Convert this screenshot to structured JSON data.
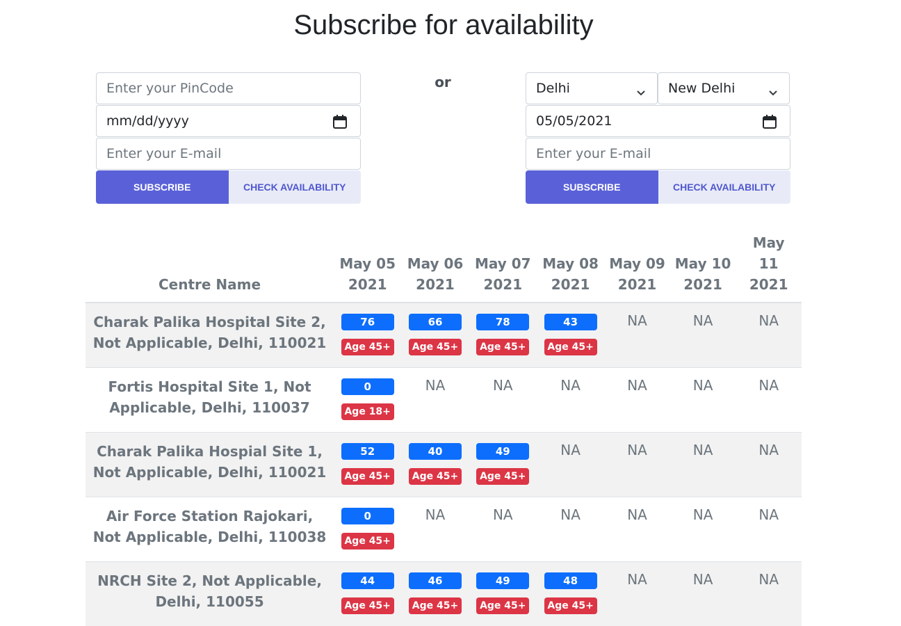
{
  "title": "Subscribe for availability",
  "or_label": "or",
  "left_form": {
    "pincode_placeholder": "Enter your PinCode",
    "date_placeholder": "mm/dd/yyyy",
    "email_placeholder": "Enter your E-mail",
    "subscribe_label": "SUBSCRIBE",
    "check_label": "CHECK AVAILABILITY"
  },
  "right_form": {
    "state_value": "Delhi",
    "district_value": "New Delhi",
    "date_value": "05/05/2021",
    "email_placeholder": "Enter your E-mail",
    "subscribe_label": "SUBSCRIBE",
    "check_label": "CHECK AVAILABILITY"
  },
  "table": {
    "centre_header": "Centre Name",
    "date_headers": [
      [
        "May 05",
        "2021"
      ],
      [
        "May 06",
        "2021"
      ],
      [
        "May 07",
        "2021"
      ],
      [
        "May 08",
        "2021"
      ],
      [
        "May 09",
        "2021"
      ],
      [
        "May 10",
        "2021"
      ],
      [
        "May",
        "11",
        "2021"
      ]
    ],
    "rows": [
      {
        "centre": "Charak Palika Hospital Site 2, Not Applicable, Delhi, 110021",
        "slots": [
          {
            "cap": "76",
            "age": "Age 45+"
          },
          {
            "cap": "66",
            "age": "Age 45+"
          },
          {
            "cap": "78",
            "age": "Age 45+"
          },
          {
            "cap": "43",
            "age": "Age 45+"
          },
          null,
          null,
          null
        ]
      },
      {
        "centre": "Fortis Hospital Site 1, Not Applicable, Delhi, 110037",
        "slots": [
          {
            "cap": "0",
            "age": "Age 18+"
          },
          null,
          null,
          null,
          null,
          null,
          null
        ]
      },
      {
        "centre": "Charak Palika Hospial Site 1, Not Applicable, Delhi, 110021",
        "slots": [
          {
            "cap": "52",
            "age": "Age 45+"
          },
          {
            "cap": "40",
            "age": "Age 45+"
          },
          {
            "cap": "49",
            "age": "Age 45+"
          },
          null,
          null,
          null,
          null
        ]
      },
      {
        "centre": "Air Force Station Rajokari, Not Applicable, Delhi, 110038",
        "slots": [
          {
            "cap": "0",
            "age": "Age 45+"
          },
          null,
          null,
          null,
          null,
          null,
          null
        ]
      },
      {
        "centre": "NRCH Site 2, Not Applicable, Delhi, 110055",
        "slots": [
          {
            "cap": "44",
            "age": "Age 45+"
          },
          {
            "cap": "46",
            "age": "Age 45+"
          },
          {
            "cap": "49",
            "age": "Age 45+"
          },
          {
            "cap": "48",
            "age": "Age 45+"
          },
          null,
          null,
          null
        ]
      }
    ],
    "na_label": "NA"
  },
  "icons": {
    "calendar": "calendar-icon",
    "chevron": "chevron-down-icon"
  },
  "colors": {
    "primary_button": "#5a61d8",
    "secondary_button": "#e8ebf7",
    "capacity_badge": "#0d6efd",
    "age_badge": "#dc3545"
  }
}
